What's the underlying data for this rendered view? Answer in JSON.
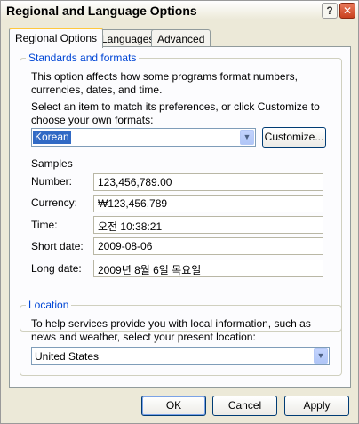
{
  "window": {
    "title": "Regional and Language Options"
  },
  "tabs": [
    "Regional Options",
    "Languages",
    "Advanced"
  ],
  "standards": {
    "legend": "Standards and formats",
    "description": "This option affects how some programs format numbers, currencies, dates, and time.",
    "instruction": "Select an item to match its preferences, or click Customize to choose your own formats:",
    "selected_format": "Korean",
    "customize_label": "Customize...",
    "samples_label": "Samples",
    "samples": [
      {
        "label": "Number:",
        "value": "123,456,789.00"
      },
      {
        "label": "Currency:",
        "value": "₩123,456,789"
      },
      {
        "label": "Time:",
        "value": "오전 10:38:21"
      },
      {
        "label": "Short date:",
        "value": "2009-08-06"
      },
      {
        "label": "Long date:",
        "value": "2009년 8월 6일 목요일"
      }
    ]
  },
  "location": {
    "legend": "Location",
    "description": "To help services provide you with local information, such as news and weather, select your present location:",
    "selected": "United States"
  },
  "buttons": {
    "ok": "OK",
    "cancel": "Cancel",
    "apply": "Apply"
  },
  "icons": {
    "help": "help-icon",
    "close": "close-icon",
    "dropdown": "chevron-down-icon"
  }
}
